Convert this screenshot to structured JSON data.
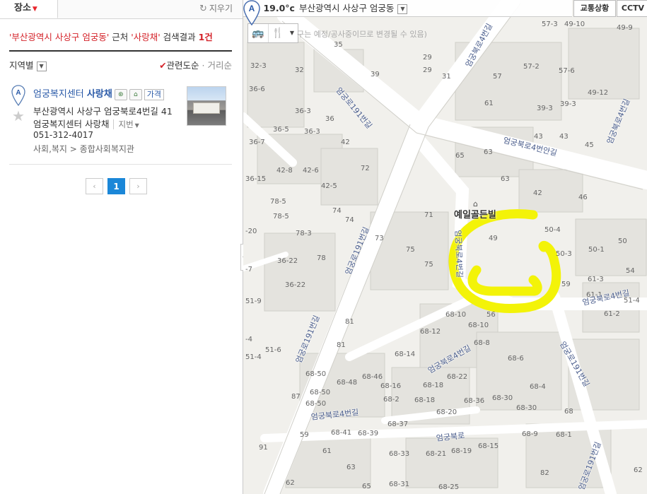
{
  "panel": {
    "tab_label": "장소",
    "clear_label": "지우기",
    "summary": {
      "q1": "'부산광역시 사상구 엄궁동'",
      "near": " 근처 ",
      "q2": "'사랑채'",
      "label": " 검색결과 ",
      "count": "1건"
    },
    "region_label": "지역별",
    "sort_active": "관련도순",
    "sort_dot": " · ",
    "sort_other": "거리순",
    "result": {
      "marker": "A",
      "name_prefix": "엄궁복지센터 ",
      "name_bold": "사랑채",
      "price_label": "가격",
      "address": "부산광역시 사상구 엄궁북로4번길 41",
      "address2": "엄궁복지센터 사랑채",
      "jibun": "지번",
      "phone": "051-312-4017",
      "category": "사회,복지 > 종합사회복지관"
    },
    "pager": {
      "prev": "‹",
      "current": "1",
      "next": "›"
    }
  },
  "map": {
    "weather_temp": "19.0°c",
    "weather_location": "부산광역시 사상구 엄궁동",
    "traffic_label": "교통상황",
    "cctv_label": "CCTV",
    "notice": "구는 예정/공사중이므로 변경될 수 있음)",
    "pin_label": "A",
    "building_label": "예일골든빌",
    "roads": [
      "엄궁북로4번길",
      "엄궁북로4번안길",
      "엄궁로191번길",
      "엄궁로191번길",
      "엄궁로191번길",
      "엄궁북로4번길",
      "엄궁북로4번길",
      "엄궁북로4번길",
      "엄궁북로4번길",
      "엄궁북로",
      "엄궁로191번길",
      "엄궁북로4번길",
      "엄궁로191번길",
      "엄궁북로4번길",
      "엄궁로191번길",
      "엄궁로191번길"
    ],
    "lots": [
      "57-3",
      "49-10",
      "49-9",
      "35",
      "29",
      "32-3",
      "32",
      "29",
      "31",
      "57-2",
      "57-6",
      "36-6",
      "39",
      "57",
      "49-12",
      "36-3",
      "61",
      "39-3",
      "39-3",
      "36-5",
      "36",
      "36-3",
      "43",
      "43",
      "45",
      "36-7",
      "42",
      "65",
      "63",
      "42-8",
      "42-6",
      "72",
      "36-15",
      "42-5",
      "63",
      "42",
      "46",
      "78-5",
      "74",
      "78-5",
      "71",
      "78-3",
      "74",
      "49",
      "50-4",
      "50",
      "-20",
      "73",
      "75",
      "50-3",
      "50-1",
      "36-22",
      "78",
      "75",
      "61-3",
      "59",
      "-7",
      "36-22",
      "61-1",
      "54",
      "51-9",
      "68-10",
      "56",
      "61-2",
      "51-4",
      "81",
      "68-12",
      "68-10",
      "-4",
      "51-6",
      "81",
      "68-8",
      "51-4",
      "68-14",
      "68-6",
      "68-50",
      "68-46",
      "68-16",
      "68-22",
      "68-48",
      "68-18",
      "68-4",
      "68-50",
      "87",
      "68-20",
      "68-36",
      "68-30",
      "68-2",
      "68-50",
      "68-18",
      "68-30",
      "68",
      "59",
      "68-41",
      "68-39",
      "68-37",
      "68-9",
      "68-1",
      "91",
      "61",
      "68-33",
      "68-21",
      "68-19",
      "68-15",
      "63",
      "82",
      "62",
      "65",
      "68-31",
      "68-25",
      "62"
    ]
  }
}
